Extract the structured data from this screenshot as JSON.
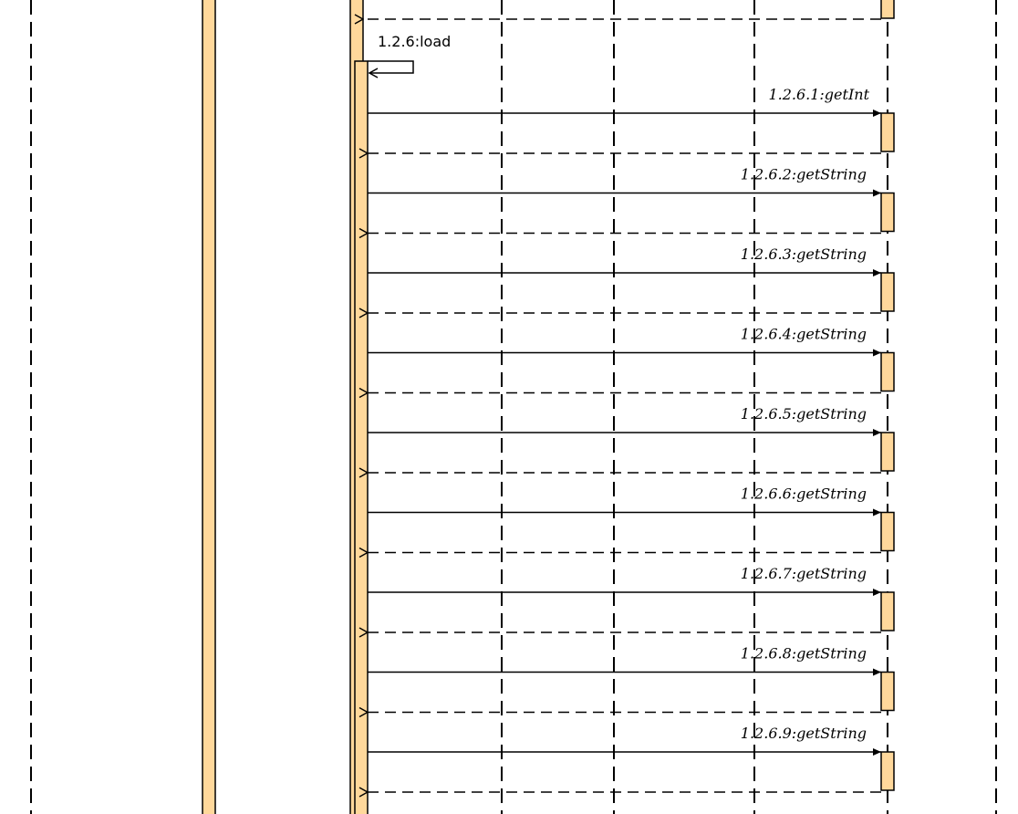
{
  "colors": {
    "activation_fill": "#ffd89b",
    "line": "#000000",
    "background": "#ffffff"
  },
  "self_message": {
    "label": "1.2.6:load"
  },
  "messages": [
    {
      "label": "1.2.6.1:getInt"
    },
    {
      "label": "1.2.6.2:getString"
    },
    {
      "label": "1.2.6.3:getString"
    },
    {
      "label": "1.2.6.4:getString"
    },
    {
      "label": "1.2.6.5:getString"
    },
    {
      "label": "1.2.6.6:getString"
    },
    {
      "label": "1.2.6.7:getString"
    },
    {
      "label": "1.2.6.8:getString"
    },
    {
      "label": "1.2.6.9:getString"
    }
  ]
}
